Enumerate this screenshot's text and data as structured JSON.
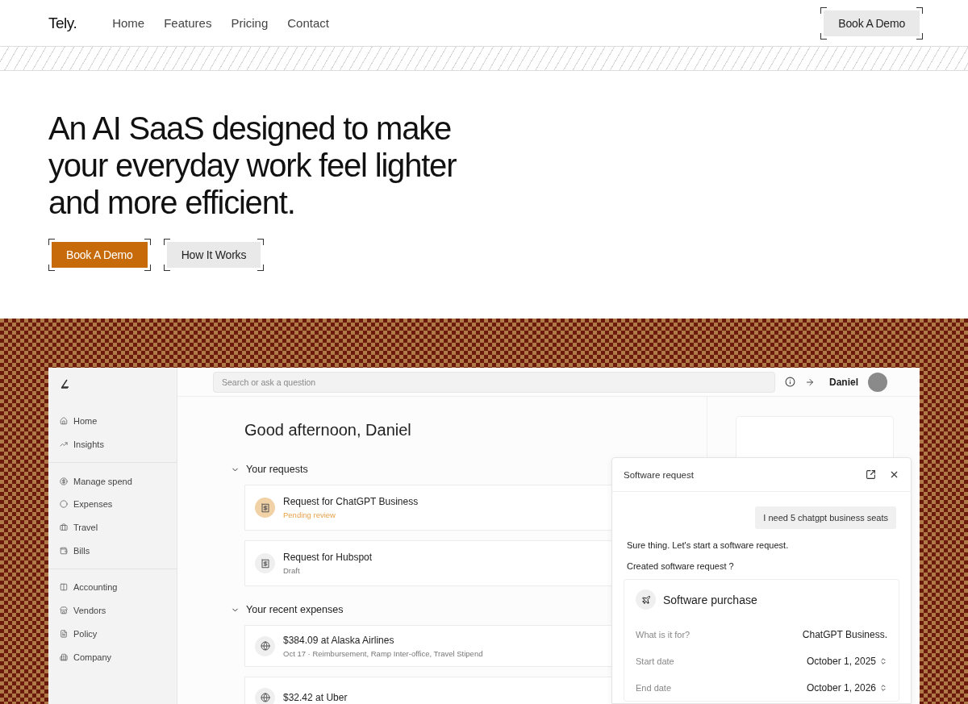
{
  "nav": {
    "logo": "Tely.",
    "links": [
      "Home",
      "Features",
      "Pricing",
      "Contact"
    ],
    "cta": "Book A Demo"
  },
  "hero": {
    "heading": "An AI SaaS designed to make your everyday work feel lighter and more efficient.",
    "buttons": [
      {
        "label": "Book A Demo",
        "kind": "primary"
      },
      {
        "label": "How It Works",
        "kind": "secondary"
      }
    ]
  },
  "app": {
    "search": {
      "placeholder": "Search or ask a question"
    },
    "user": "Daniel",
    "sidebar": {
      "groups": [
        [
          {
            "label": "Home"
          },
          {
            "label": "Insights"
          }
        ],
        [
          {
            "label": "Manage spend"
          },
          {
            "label": "Expenses"
          },
          {
            "label": "Travel"
          },
          {
            "label": "Bills"
          }
        ],
        [
          {
            "label": "Accounting"
          },
          {
            "label": "Vendors"
          },
          {
            "label": "Policy"
          },
          {
            "label": "Company"
          }
        ]
      ]
    },
    "greeting": "Good afternoon, Daniel",
    "sections": [
      {
        "title": "Your requests",
        "expanded": true,
        "items": [
          {
            "title": "Request for ChatGPT Business",
            "subtitle": "Pending review",
            "kind": "pending",
            "highlighted": true
          },
          {
            "title": "Request for Hubspot",
            "subtitle": "Draft",
            "kind": "draft",
            "highlighted": false
          }
        ]
      },
      {
        "title": "Your recent expenses",
        "expanded": true,
        "items": [
          {
            "title": "$384.09 at Alaska Airlines",
            "subtitle": "Oct 17 · Reimbursement, Ramp Inter-office, Travel Stipend",
            "highlighted": false
          },
          {
            "title": "$32.42 at Uber",
            "highlighted": false
          }
        ]
      }
    ],
    "panel": {
      "title": "Software request",
      "user_message": "I need 5 chatgpt business seats",
      "replies": [
        "Sure thing. Let's start a software request.",
        "Created software request ?"
      ],
      "card": {
        "title": "Software purchase",
        "rows": [
          {
            "label": "What is it for?",
            "value": "ChatGPT Business.",
            "kind": "text"
          },
          {
            "label": "Start date",
            "value": "October 1, 2025",
            "kind": "select"
          },
          {
            "label": "End date",
            "value": "October 1, 2026",
            "kind": "select"
          }
        ]
      }
    }
  }
}
